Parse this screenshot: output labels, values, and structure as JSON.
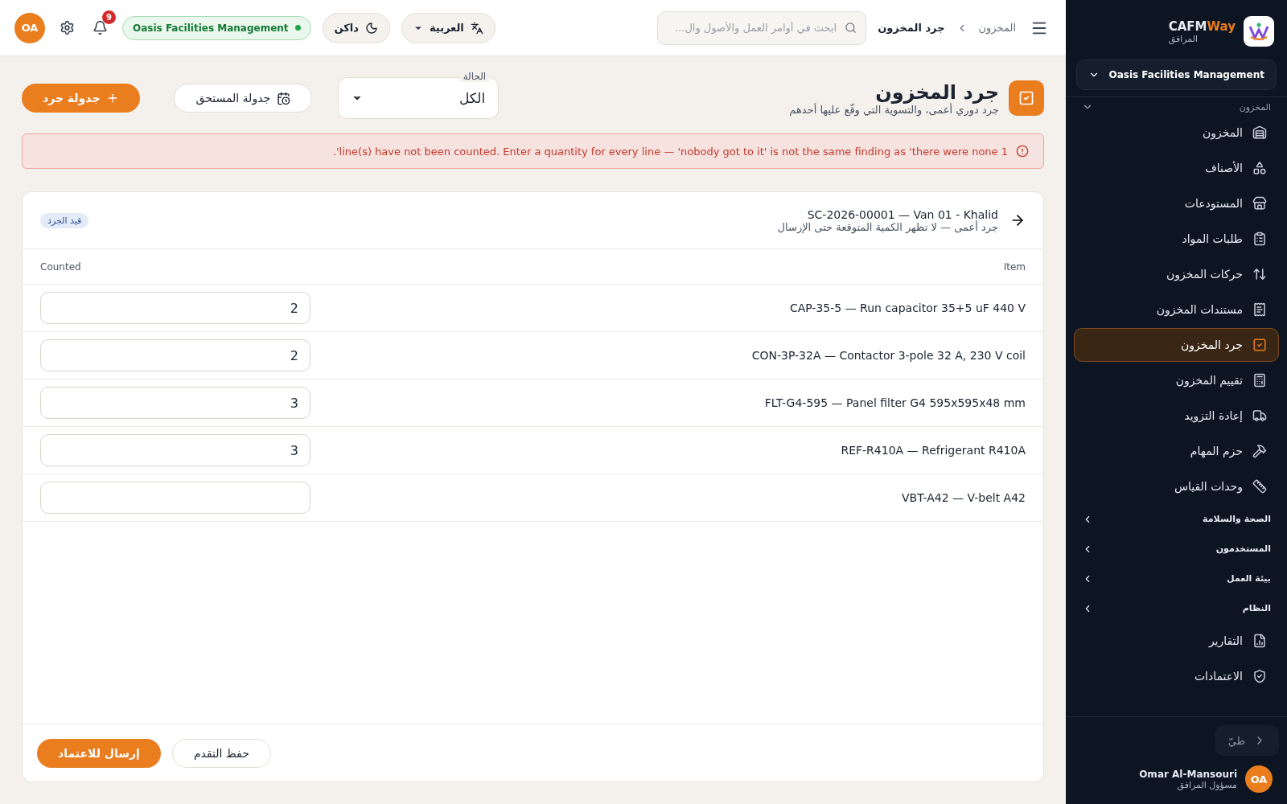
{
  "sidebar": {
    "brand": {
      "name_a": "CAFM",
      "name_b": "Way",
      "subtitle": "المرافق"
    },
    "org_select": "Oasis Facilities Management",
    "section": {
      "label": "المخزون",
      "expanded": true
    },
    "items": [
      {
        "kind": "link",
        "label": "المخزون",
        "selected": false
      },
      {
        "kind": "link",
        "label": "الأصناف",
        "selected": false
      },
      {
        "kind": "link",
        "label": "المستودعات",
        "selected": false
      },
      {
        "kind": "link",
        "label": "طلبات المواد",
        "selected": false
      },
      {
        "kind": "link",
        "label": "حركات المخزون",
        "selected": false
      },
      {
        "kind": "link",
        "label": "مستندات المخزون",
        "selected": false
      },
      {
        "kind": "link",
        "label": "جرد المخزون",
        "selected": true
      },
      {
        "kind": "link",
        "label": "تقييم المخزون",
        "selected": false
      },
      {
        "kind": "link",
        "label": "إعادة التزويد",
        "selected": false
      },
      {
        "kind": "link",
        "label": "حزم المهام",
        "selected": false
      },
      {
        "kind": "link",
        "label": "وحدات القياس",
        "selected": false
      },
      {
        "kind": "group",
        "label": "الصحة والسلامة",
        "expanded": false
      },
      {
        "kind": "group",
        "label": "المستخدمون",
        "expanded": false
      },
      {
        "kind": "group",
        "label": "بيئة العمل",
        "expanded": false
      },
      {
        "kind": "group",
        "label": "النظام",
        "expanded": false
      },
      {
        "kind": "link",
        "label": "التقارير",
        "selected": false
      },
      {
        "kind": "link",
        "label": "الاعتمادات",
        "selected": false
      }
    ],
    "collapse_label": "طيّ",
    "user": {
      "initials": "OA",
      "name": "Omar Al-Mansouri",
      "role": "مسؤول المرافق"
    }
  },
  "header": {
    "breadcrumbs": [
      "المخزون",
      "جرد المخزون"
    ],
    "search": {
      "placeholder": "ابحث في أوامر العمل والأصول وال..."
    },
    "language": "العربية",
    "theme": "داكن",
    "org_badge": "Oasis Facilities Management",
    "notifications": "9",
    "avatar": "OA"
  },
  "page": {
    "title": "جرد المخزون",
    "subtitle": "جرد دوري أعمى، والتسوية التي وقّع عليها أحدهم",
    "status_filter": {
      "label": "الحالة",
      "value": "الكل"
    },
    "due_button": "جدولة المستحق",
    "new_button": "جدولة جرد"
  },
  "alert": "1 line(s) have not been counted. Enter a quantity for every line — 'nobody got to it' is not the same finding as 'there were none'.",
  "count": {
    "title": "SC-2026-00001 — Van 01 - Khalid",
    "subtitle": "جرد أعمى — لا تظهر الكمية المتوقعة حتى الإرسال",
    "status": "قيد الجرد",
    "columns": [
      "Item",
      "Counted"
    ],
    "rows": [
      {
        "item": "CAP-35-5 — Run capacitor 35+5 uF 440 V",
        "counted": "2"
      },
      {
        "item": "CON-3P-32A — Contactor 3-pole 32 A, 230 V coil",
        "counted": "2"
      },
      {
        "item": "FLT-G4-595 — Panel filter G4 595x595x48 mm",
        "counted": "3"
      },
      {
        "item": "REF-R410A — Refrigerant R410A",
        "counted": "3"
      },
      {
        "item": "VBT-A42 — V-belt A42"
      }
    ],
    "save_button": "حفظ التقدم",
    "submit_button": "إرسال للاعتماد"
  }
}
